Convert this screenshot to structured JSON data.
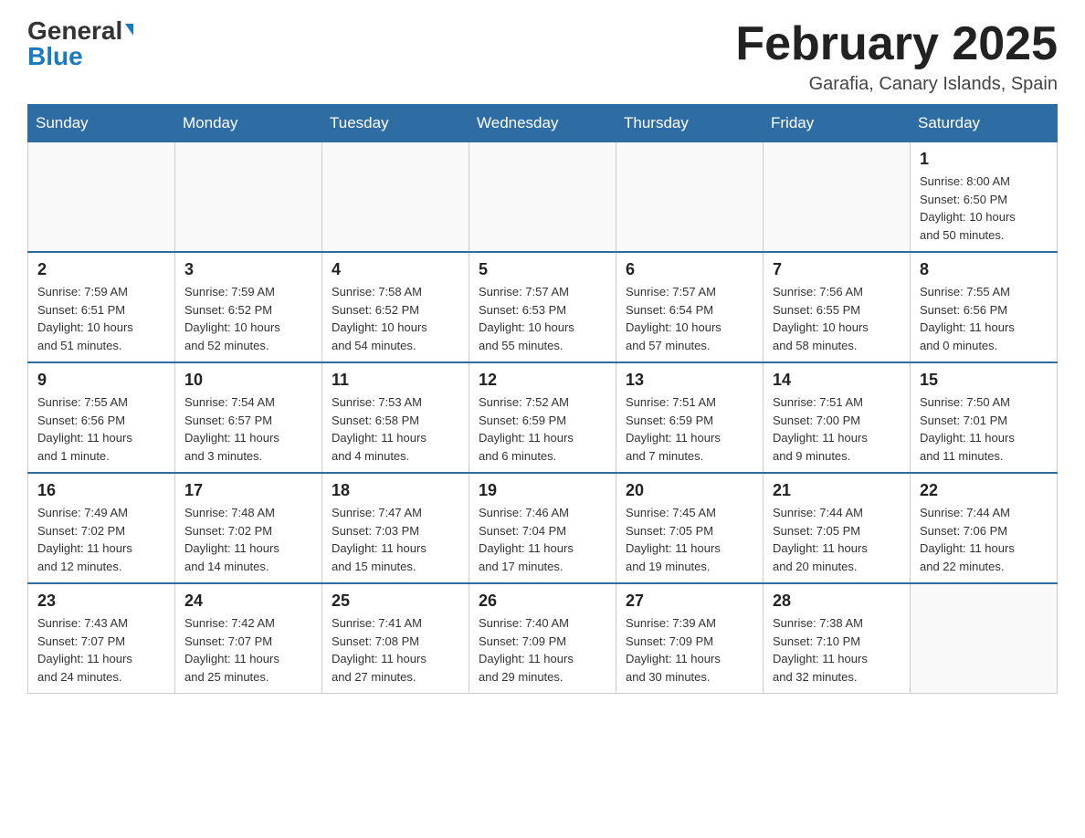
{
  "logo": {
    "general": "General",
    "blue": "Blue",
    "triangle": "▲"
  },
  "header": {
    "title": "February 2025",
    "subtitle": "Garafia, Canary Islands, Spain"
  },
  "weekdays": [
    "Sunday",
    "Monday",
    "Tuesday",
    "Wednesday",
    "Thursday",
    "Friday",
    "Saturday"
  ],
  "weeks": [
    [
      {
        "day": "",
        "info": ""
      },
      {
        "day": "",
        "info": ""
      },
      {
        "day": "",
        "info": ""
      },
      {
        "day": "",
        "info": ""
      },
      {
        "day": "",
        "info": ""
      },
      {
        "day": "",
        "info": ""
      },
      {
        "day": "1",
        "info": "Sunrise: 8:00 AM\nSunset: 6:50 PM\nDaylight: 10 hours\nand 50 minutes."
      }
    ],
    [
      {
        "day": "2",
        "info": "Sunrise: 7:59 AM\nSunset: 6:51 PM\nDaylight: 10 hours\nand 51 minutes."
      },
      {
        "day": "3",
        "info": "Sunrise: 7:59 AM\nSunset: 6:52 PM\nDaylight: 10 hours\nand 52 minutes."
      },
      {
        "day": "4",
        "info": "Sunrise: 7:58 AM\nSunset: 6:52 PM\nDaylight: 10 hours\nand 54 minutes."
      },
      {
        "day": "5",
        "info": "Sunrise: 7:57 AM\nSunset: 6:53 PM\nDaylight: 10 hours\nand 55 minutes."
      },
      {
        "day": "6",
        "info": "Sunrise: 7:57 AM\nSunset: 6:54 PM\nDaylight: 10 hours\nand 57 minutes."
      },
      {
        "day": "7",
        "info": "Sunrise: 7:56 AM\nSunset: 6:55 PM\nDaylight: 10 hours\nand 58 minutes."
      },
      {
        "day": "8",
        "info": "Sunrise: 7:55 AM\nSunset: 6:56 PM\nDaylight: 11 hours\nand 0 minutes."
      }
    ],
    [
      {
        "day": "9",
        "info": "Sunrise: 7:55 AM\nSunset: 6:56 PM\nDaylight: 11 hours\nand 1 minute."
      },
      {
        "day": "10",
        "info": "Sunrise: 7:54 AM\nSunset: 6:57 PM\nDaylight: 11 hours\nand 3 minutes."
      },
      {
        "day": "11",
        "info": "Sunrise: 7:53 AM\nSunset: 6:58 PM\nDaylight: 11 hours\nand 4 minutes."
      },
      {
        "day": "12",
        "info": "Sunrise: 7:52 AM\nSunset: 6:59 PM\nDaylight: 11 hours\nand 6 minutes."
      },
      {
        "day": "13",
        "info": "Sunrise: 7:51 AM\nSunset: 6:59 PM\nDaylight: 11 hours\nand 7 minutes."
      },
      {
        "day": "14",
        "info": "Sunrise: 7:51 AM\nSunset: 7:00 PM\nDaylight: 11 hours\nand 9 minutes."
      },
      {
        "day": "15",
        "info": "Sunrise: 7:50 AM\nSunset: 7:01 PM\nDaylight: 11 hours\nand 11 minutes."
      }
    ],
    [
      {
        "day": "16",
        "info": "Sunrise: 7:49 AM\nSunset: 7:02 PM\nDaylight: 11 hours\nand 12 minutes."
      },
      {
        "day": "17",
        "info": "Sunrise: 7:48 AM\nSunset: 7:02 PM\nDaylight: 11 hours\nand 14 minutes."
      },
      {
        "day": "18",
        "info": "Sunrise: 7:47 AM\nSunset: 7:03 PM\nDaylight: 11 hours\nand 15 minutes."
      },
      {
        "day": "19",
        "info": "Sunrise: 7:46 AM\nSunset: 7:04 PM\nDaylight: 11 hours\nand 17 minutes."
      },
      {
        "day": "20",
        "info": "Sunrise: 7:45 AM\nSunset: 7:05 PM\nDaylight: 11 hours\nand 19 minutes."
      },
      {
        "day": "21",
        "info": "Sunrise: 7:44 AM\nSunset: 7:05 PM\nDaylight: 11 hours\nand 20 minutes."
      },
      {
        "day": "22",
        "info": "Sunrise: 7:44 AM\nSunset: 7:06 PM\nDaylight: 11 hours\nand 22 minutes."
      }
    ],
    [
      {
        "day": "23",
        "info": "Sunrise: 7:43 AM\nSunset: 7:07 PM\nDaylight: 11 hours\nand 24 minutes."
      },
      {
        "day": "24",
        "info": "Sunrise: 7:42 AM\nSunset: 7:07 PM\nDaylight: 11 hours\nand 25 minutes."
      },
      {
        "day": "25",
        "info": "Sunrise: 7:41 AM\nSunset: 7:08 PM\nDaylight: 11 hours\nand 27 minutes."
      },
      {
        "day": "26",
        "info": "Sunrise: 7:40 AM\nSunset: 7:09 PM\nDaylight: 11 hours\nand 29 minutes."
      },
      {
        "day": "27",
        "info": "Sunrise: 7:39 AM\nSunset: 7:09 PM\nDaylight: 11 hours\nand 30 minutes."
      },
      {
        "day": "28",
        "info": "Sunrise: 7:38 AM\nSunset: 7:10 PM\nDaylight: 11 hours\nand 32 minutes."
      },
      {
        "day": "",
        "info": ""
      }
    ]
  ]
}
